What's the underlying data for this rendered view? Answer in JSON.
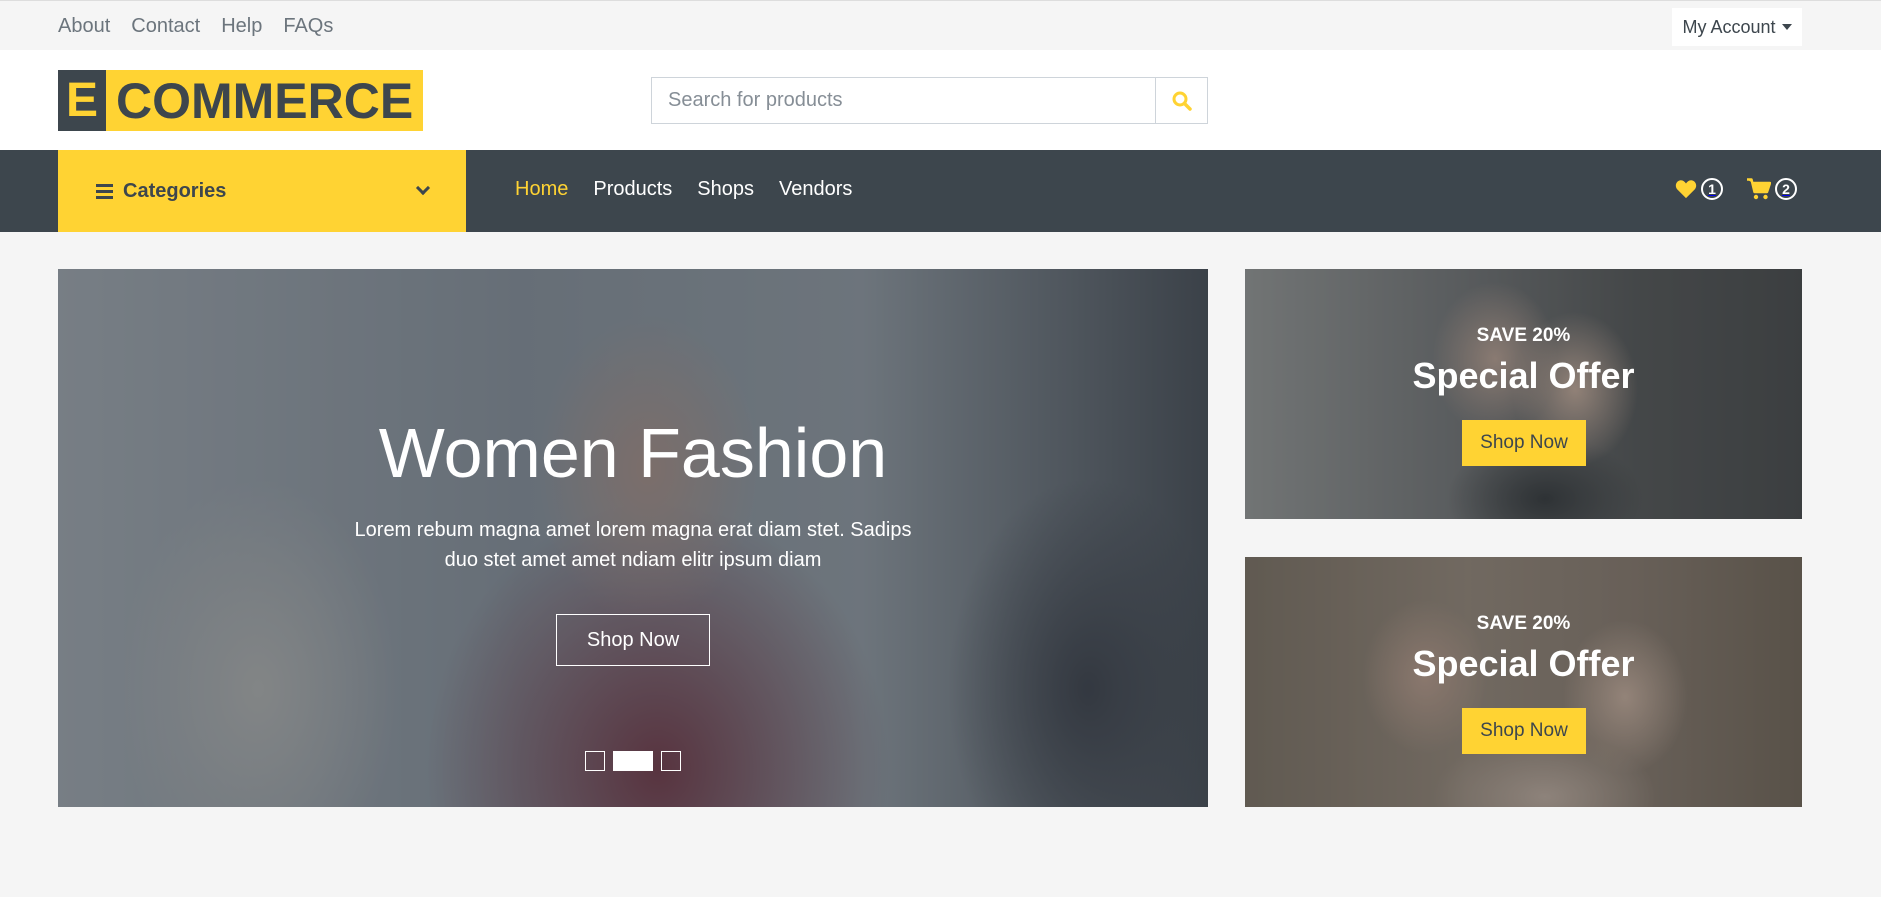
{
  "topbar": {
    "links": [
      "About",
      "Contact",
      "Help",
      "FAQs"
    ],
    "account_label": "My Account"
  },
  "header": {
    "logo_letter": "E",
    "logo_text": "COMMERCE",
    "search_placeholder": "Search for products"
  },
  "navbar": {
    "categories_label": "Categories",
    "links": [
      {
        "label": "Home",
        "active": true
      },
      {
        "label": "Products",
        "active": false
      },
      {
        "label": "Shops",
        "active": false
      },
      {
        "label": "Vendors",
        "active": false
      }
    ],
    "wishlist_count": "1",
    "cart_count": "2"
  },
  "carousel": {
    "title": "Women Fashion",
    "description": "Lorem rebum magna amet lorem magna erat diam stet. Sadips duo stet amet amet ndiam elitr ipsum diam",
    "button_label": "Shop Now",
    "slides": 3,
    "active_slide": 2
  },
  "offers": [
    {
      "save": "SAVE 20%",
      "title": "Special Offer",
      "button_label": "Shop Now"
    },
    {
      "save": "SAVE 20%",
      "title": "Special Offer",
      "button_label": "Shop Now"
    }
  ],
  "colors": {
    "accent": "#ffd333",
    "dark": "#3d464d",
    "background": "#f5f5f5"
  }
}
